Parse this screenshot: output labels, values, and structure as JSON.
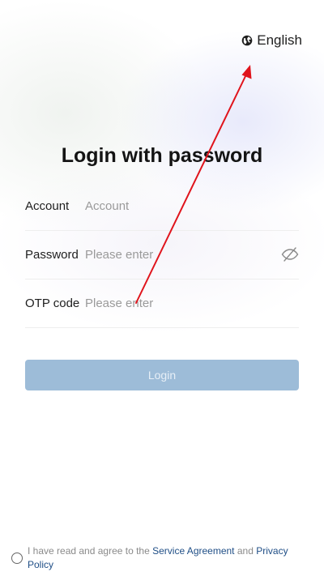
{
  "header": {
    "language_label": "English",
    "language_icon": "globe-icon"
  },
  "page": {
    "title": "Login with password"
  },
  "form": {
    "account": {
      "label": "Account",
      "placeholder": "Account",
      "value": ""
    },
    "password": {
      "label": "Password",
      "placeholder": "Please enter",
      "value": "",
      "toggle_icon": "eye-off-icon"
    },
    "otp": {
      "label": "OTP code",
      "placeholder": "Please enter",
      "value": ""
    }
  },
  "actions": {
    "login_label": "Login"
  },
  "agreement": {
    "prefix": "I have read and agree to the",
    "service_link": "Service Agreement",
    "conjunction": "and",
    "privacy_link": "Privacy Policy",
    "checked": false
  },
  "colors": {
    "login_button_disabled": "#9dbcd8",
    "link": "#1f4e86",
    "annotation_arrow": "#e0141c"
  }
}
